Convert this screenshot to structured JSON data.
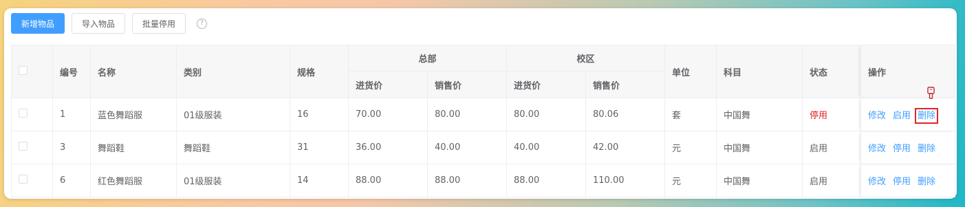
{
  "toolbar": {
    "add_label": "新增物品",
    "import_label": "导入物品",
    "batch_disable_label": "批量停用",
    "help_symbol": "?"
  },
  "table": {
    "headers": {
      "id": "编号",
      "name": "名称",
      "category": "类别",
      "spec": "规格",
      "hq": "总部",
      "campus": "校区",
      "purchase_price": "进货价",
      "sale_price": "销售价",
      "unit": "单位",
      "subject": "科目",
      "status": "状态",
      "actions": "操作"
    },
    "rows": [
      {
        "id": "1",
        "name": "蓝色舞蹈服",
        "category": "01级服装",
        "spec": "16",
        "hq_purchase": "70.00",
        "hq_sale": "80.00",
        "campus_purchase": "80.00",
        "campus_sale": "80.06",
        "unit": "套",
        "subject": "中国舞",
        "status": "停用",
        "actions": [
          "修改",
          "启用",
          "删除"
        ]
      },
      {
        "id": "3",
        "name": "舞蹈鞋",
        "category": "舞蹈鞋",
        "spec": "31",
        "hq_purchase": "36.00",
        "hq_sale": "40.00",
        "campus_purchase": "40.00",
        "campus_sale": "42.00",
        "unit": "元",
        "subject": "中国舞",
        "status": "启用",
        "actions": [
          "修改",
          "停用",
          "删除"
        ]
      },
      {
        "id": "6",
        "name": "红色舞蹈服",
        "category": "01级服装",
        "spec": "14",
        "hq_purchase": "88.00",
        "hq_sale": "88.00",
        "campus_purchase": "88.00",
        "campus_sale": "110.00",
        "unit": "元",
        "subject": "中国舞",
        "status": "启用",
        "actions": [
          "修改",
          "停用",
          "删除"
        ]
      }
    ]
  },
  "colors": {
    "primary": "#409eff",
    "danger": "#e02020",
    "highlight": "#e0242b"
  }
}
